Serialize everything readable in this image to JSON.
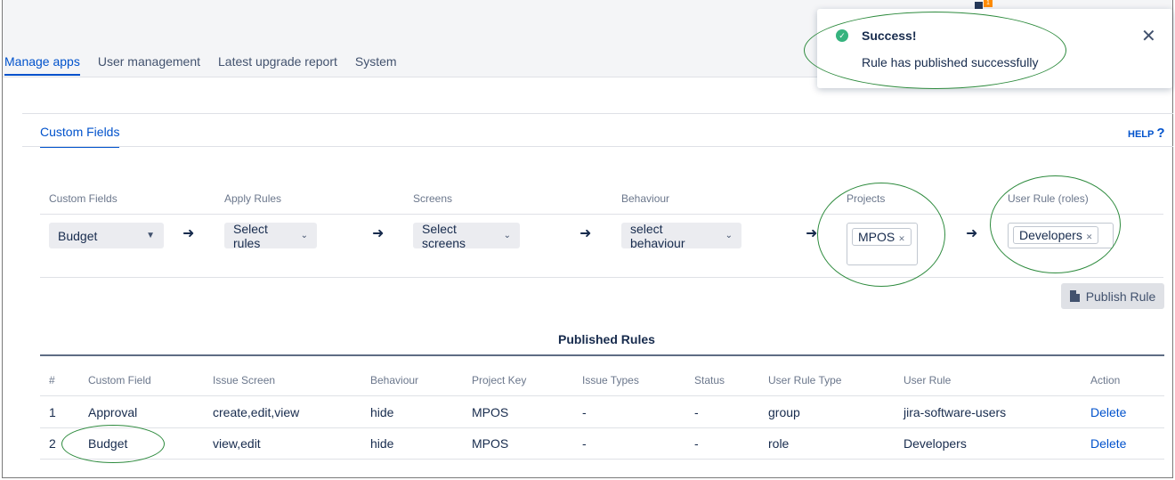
{
  "nav": {
    "tabs": [
      {
        "label": "Manage apps",
        "active": true
      },
      {
        "label": "User management"
      },
      {
        "label": "Latest upgrade report"
      },
      {
        "label": "System"
      }
    ]
  },
  "notification_badge": "1",
  "panel": {
    "subtab": "Custom Fields",
    "help_label": "HELP",
    "help_icon": "?"
  },
  "rule_builder": {
    "labels": {
      "custom_fields": "Custom Fields",
      "apply_rules": "Apply Rules",
      "screens": "Screens",
      "behaviour": "Behaviour",
      "projects": "Projects",
      "user_rule": "User Rule (roles)"
    },
    "custom_field_value": "Budget",
    "apply_rules_value": "Select rules",
    "screens_value": "Select screens",
    "behaviour_value": "select behaviour",
    "projects_chip": "MPOS",
    "user_rule_chip": "Developers",
    "arrow": "➜",
    "publish_label": "Publish Rule"
  },
  "published": {
    "title": "Published Rules",
    "columns": [
      "#",
      "Custom Field",
      "Issue Screen",
      "Behaviour",
      "Project Key",
      "Issue Types",
      "Status",
      "User Rule Type",
      "User Rule",
      "Action"
    ],
    "rows": [
      [
        "1",
        "Approval",
        "create,edit,view",
        "hide",
        "MPOS",
        "-",
        "-",
        "group",
        "jira-software-users",
        "Delete"
      ],
      [
        "2",
        "Budget",
        "view,edit",
        "hide",
        "MPOS",
        "-",
        "-",
        "role",
        "Developers",
        "Delete"
      ]
    ]
  },
  "toast": {
    "title": "Success!",
    "message": "Rule has published successfully",
    "close": "✕",
    "check": "✓"
  },
  "colors": {
    "accent": "#0052cc",
    "success": "#36b37e",
    "annotation": "#2e8b3e"
  }
}
